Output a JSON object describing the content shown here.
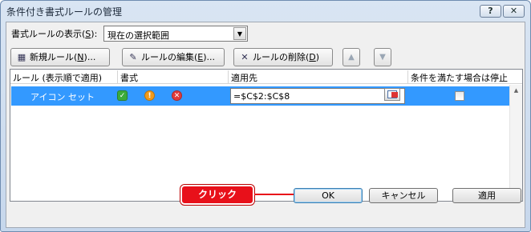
{
  "window": {
    "title": "条件付き書式ルールの管理",
    "help_button": "?",
    "close_button": "✕"
  },
  "show_rules_for": {
    "label_before": "書式ルールの表示(",
    "accelerator": "S",
    "label_after": "):",
    "selected": "現在の選択範囲"
  },
  "toolbar": {
    "new_label": "新規ルール(",
    "new_key": "N",
    "new_suffix": ")...",
    "edit_label": "ルールの編集(",
    "edit_key": "E",
    "edit_suffix": ")...",
    "delete_label": "ルールの削除(",
    "delete_key": "D",
    "delete_suffix": ")"
  },
  "grid": {
    "columns": [
      "ルール (表示順で適用)",
      "書式",
      "適用先",
      "条件を満たす場合は停止"
    ],
    "rows": [
      {
        "rule": "アイコン セット",
        "format_icons": [
          "check-icon",
          "exclamation-icon",
          "cross-icon"
        ],
        "applies_to": "=$C$2:$C$8",
        "stop_if_true": false
      }
    ]
  },
  "callout": {
    "text": "クリック",
    "color": "#e8101a"
  },
  "buttons": {
    "ok": "OK",
    "cancel": "キャンセル",
    "apply": "適用"
  },
  "colors": {
    "selection": "#3399ff"
  }
}
